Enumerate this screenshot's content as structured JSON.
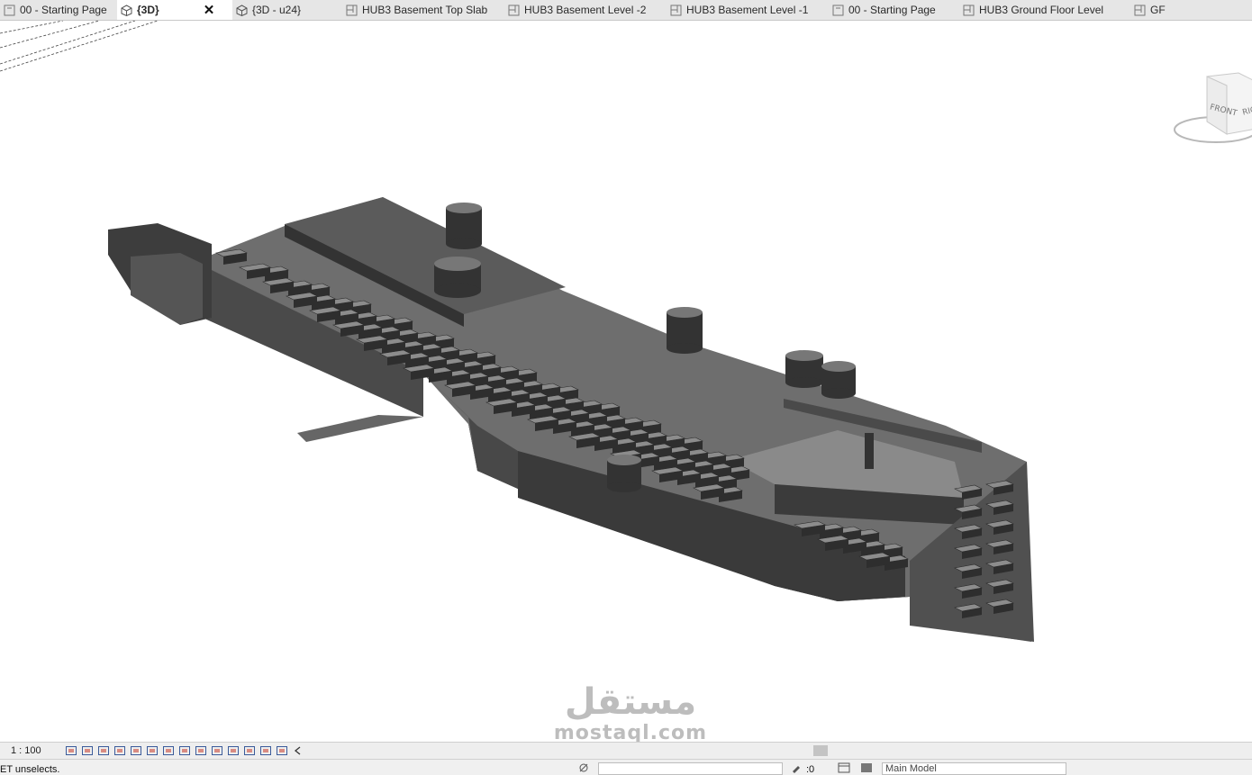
{
  "tabs": [
    {
      "label": "00 - Starting Page",
      "icon": "sheet-icon"
    },
    {
      "label": "{3D}",
      "icon": "3d-view-icon",
      "active": true,
      "close": "✕"
    },
    {
      "label": "{3D - u24}",
      "icon": "3d-view-icon"
    },
    {
      "label": "HUB3 Basement Top Slab",
      "icon": "floor-plan-icon"
    },
    {
      "label": "HUB3 Basement Level -2",
      "icon": "floor-plan-icon"
    },
    {
      "label": "HUB3 Basement Level -1",
      "icon": "floor-plan-icon"
    },
    {
      "label": "00 - Starting Page",
      "icon": "sheet-icon"
    },
    {
      "label": "HUB3 Ground Floor Level",
      "icon": "floor-plan-icon"
    },
    {
      "label": "GF",
      "icon": "floor-plan-icon"
    }
  ],
  "viewcube": {
    "front": "FRONT",
    "right": "RIG"
  },
  "view_controls": {
    "scale": "1 : 100",
    "icons": [
      "detail-level-icon",
      "visual-style-icon",
      "sun-path-icon",
      "shadows-icon",
      "render-icon",
      "crop-view-icon",
      "show-crop-icon",
      "unlock-3d-icon",
      "temporary-hide-icon",
      "reveal-hidden-icon",
      "worksharing-icon",
      "highlight-icon",
      "analytical-model-icon",
      "constraints-icon",
      "collapse-icon"
    ]
  },
  "status": {
    "message": "ET unselects.",
    "workset_value": "",
    "editable_count": ":0",
    "model": "Main Model"
  },
  "watermark": {
    "arabic": "مستقل",
    "latin": "mostaql.com"
  },
  "colors": {
    "model_dark": "#3c3c3c",
    "model_mid": "#5a5a5a",
    "model_light": "#7a7a7a",
    "tabbar": "#e6e6e6"
  }
}
